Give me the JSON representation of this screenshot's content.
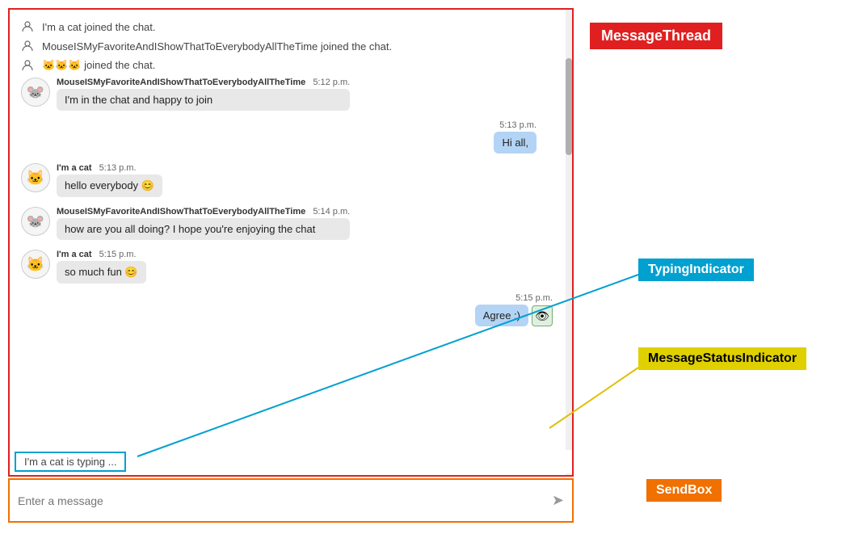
{
  "labels": {
    "messageThread": "MessageThread",
    "typingIndicator": "TypingIndicator",
    "messageStatusIndicator": "MessageStatusIndicator",
    "sendBox": "SendBox"
  },
  "systemMessages": [
    {
      "id": "sys1",
      "text": "I'm a cat joined the chat."
    },
    {
      "id": "sys2",
      "text": "MouseISMyFavoriteAndIShowThatToEverybodyAllTheTime joined the chat."
    },
    {
      "id": "sys3",
      "text": "🐱🐱🐱 joined the chat."
    }
  ],
  "messages": [
    {
      "id": "msg1",
      "side": "left",
      "avatar": "🐭",
      "name": "MouseISMyFavoriteAndIShowThatToEverybodyAllTheTime",
      "time": "5:12 p.m.",
      "text": "I'm in the chat and happy to join"
    },
    {
      "id": "msg2",
      "side": "right",
      "time": "5:13 p.m.",
      "text": "Hi all,"
    },
    {
      "id": "msg3",
      "side": "left",
      "avatar": "🐱",
      "name": "I'm a cat",
      "time": "5:13 p.m.",
      "text": "hello everybody 😊"
    },
    {
      "id": "msg4",
      "side": "left",
      "avatar": "🐭",
      "name": "MouseISMyFavoriteAndIShowThatToEverybodyAllTheTime",
      "time": "5:14 p.m.",
      "text": "how are you all doing? I hope you're enjoying the chat"
    },
    {
      "id": "msg5",
      "side": "left",
      "avatar": "🐱",
      "name": "I'm a cat",
      "time": "5:15 p.m.",
      "text": "so much fun 😊"
    },
    {
      "id": "msg6",
      "side": "right",
      "time": "5:15 p.m.",
      "text": "Agree :)",
      "hasStatus": true
    }
  ],
  "typingText": "I'm a cat is typing ...",
  "sendBoxPlaceholder": "Enter a message",
  "sendIcon": "➤"
}
